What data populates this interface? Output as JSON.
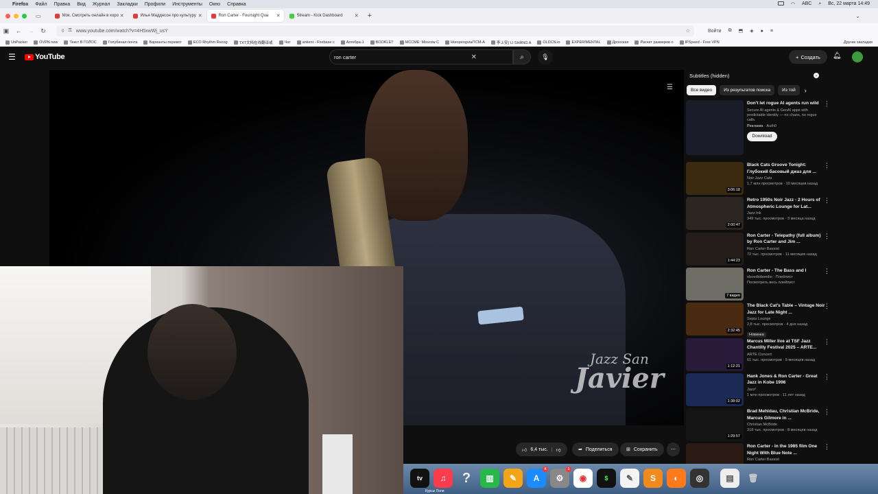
{
  "menubar": {
    "app": "Firefox",
    "items": [
      "Файл",
      "Правка",
      "Вид",
      "Журнал",
      "Закладки",
      "Профили",
      "Инструменты",
      "Окно",
      "Справка"
    ],
    "lang": "ABC",
    "datetime": "Вс, 22 марта 14:49"
  },
  "tabs": [
    {
      "label": "Мок. Смотреть онлайн в хоро",
      "color": "#e23b3b"
    },
    {
      "label": "Илья Мадднсон про культуру",
      "color": "#e23b3b"
    },
    {
      "label": "Ron Carter - Foursight Qua",
      "color": "#e23b3b"
    },
    {
      "label": "Stream - Kick Dashboard",
      "color": "#3fcf3f"
    }
  ],
  "nav": {
    "url": "www.youtube.com/watch?v=4H5xwWj_usY",
    "login": "Войти"
  },
  "bookmarks": [
    "UnPacker",
    "OVPN new",
    "Текст В ГОЛОС",
    "Голубиная почта",
    "Варианты перевет",
    "ECO Rhythm Recog",
    "TXT文档在线翻译或",
    "Чат",
    "antient - Firebase c",
    "Алгебра-1",
    "BOOKLET",
    "MCCME: Moscow C",
    "kkeopengvia/TCM-A",
    "李上安( LI SHANG A",
    "OLDCN.io",
    "EXPERIMENTAL",
    "Дросская",
    "Расчет размеров о",
    "IPSpeed - Free VPN"
  ],
  "bookmarks_other": "Другие закладки",
  "youtube": {
    "logo": "YouTube",
    "search_value": "ron carter",
    "create": "Создать"
  },
  "video": {
    "watermark_line1": "Jazz San",
    "watermark_line2": "Javier",
    "likes": "6,4 тыс.",
    "share": "Поделиться",
    "save": "Сохранить"
  },
  "sidebar": {
    "subtitles": "Subtitles (hidden)",
    "chips": [
      "Все видео",
      "Из результатов поиска",
      "Из той"
    ],
    "ad": {
      "title": "Don't let rogue AI agents run wild",
      "desc": "Secure AI agents & GenAI apps with predictable identity — no chaos, no rogue calls.",
      "sponsor": "Реклама",
      "brand": "Auth0",
      "cta": "Download"
    },
    "recs": [
      {
        "title": "Black Cats Groove Tonight: Глубокий басовый джаз для ...",
        "channel": "Noir Jazz Cats",
        "stats": "1,7 млн просмотров · 10 месяцев назад",
        "duration": "3:06:18",
        "color": "#3a2a10"
      },
      {
        "title": "Retro 1950s Noir Jazz - 2 Hours of Atmospheric Lounge for Lat...",
        "channel": "Jazz Ink",
        "stats": "349 тыс. просмотров · 3 месяца назад",
        "duration": "2:00:47",
        "color": "#2a2520"
      },
      {
        "title": "Ron Carter - Telepathy (full album) by Ron Carter and Jim ...",
        "channel": "Ron Carter Bassist",
        "stats": "72 тыс. просмотров · 11 месяцев назад",
        "duration": "1:44:23",
        "color": "#241c18"
      },
      {
        "title": "Ron Carter - The Bass and I",
        "channel": "oboedioboedio · Плейлист",
        "stats": "Посмотреть весь плейлист",
        "duration": "7 видео",
        "color": "#6e6e66"
      },
      {
        "title": "The Black Cat's Table – Vintage Noir Jazz for Late Night ...",
        "channel": "Sepia Lounge",
        "stats": "2,8 тыс. просмотров · 4 дня назад",
        "duration": "2:32:45",
        "badge": "Новинка",
        "color": "#4a2a10"
      },
      {
        "title": "Marcus Miller live at TSF Jazz Chantilly Festival 2025 – ARTE...",
        "channel": "ARTE Concert",
        "stats": "61 тыс. просмотров · 5 месяцев назад",
        "duration": "1:12:21",
        "color": "#2a1a3a"
      },
      {
        "title": "Hank Jones & Ron Carter - Great Jazz in Kobe 1996",
        "channel": "Jazz²",
        "stats": "1 млн просмотров · 11 лет назад",
        "duration": "1:38:02",
        "color": "#1a2a55"
      },
      {
        "title": "Brad Mehldau, Christian McBride, Marcus Gilmore in ...",
        "channel": "Christian McBride",
        "stats": "318 тыс. просмотров · 8 месяцев назад",
        "duration": "1:29:57",
        "color": "#141414"
      },
      {
        "title": "Ron Carter - in the 1985 film One Night With Blue Note ...",
        "channel": "Ron Carter Bassist",
        "stats": "",
        "duration": "",
        "color": "#2a1a14"
      }
    ]
  },
  "dock": {
    "label": "Курсы Поли"
  }
}
